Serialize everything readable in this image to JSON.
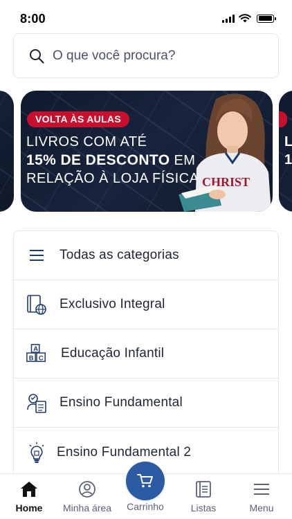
{
  "status_bar": {
    "time": "8:00"
  },
  "search": {
    "placeholder": "O que você procura?"
  },
  "banner": {
    "tag": "VOLTA ÀS AULAS",
    "line1": "LIVROS COM ATÉ",
    "highlight": "15% DE DESCONTO",
    "line2_suffix": " EM",
    "line3": "RELAÇÃO À LOJA FÍSICA",
    "shirt_text": "CHRIST",
    "next_line1": "L",
    "next_line2": "1"
  },
  "categories": {
    "items": [
      {
        "label": "Todas as categorias",
        "icon": "menu-icon"
      },
      {
        "label": "Exclusivo Integral",
        "icon": "book-globe-icon"
      },
      {
        "label": "Educação Infantil",
        "icon": "abc-blocks-icon"
      },
      {
        "label": "Ensino Fundamental",
        "icon": "student-book-icon"
      },
      {
        "label": "Ensino Fundamental 2",
        "icon": "lightbulb-icon"
      }
    ]
  },
  "bottom_nav": {
    "home": "Home",
    "account": "Minha área",
    "cart": "Carrinho",
    "lists": "Listas",
    "menu": "Menu",
    "active": "home"
  },
  "colors": {
    "primary": "#2c5ba3",
    "banner_bg": "#131d33",
    "tag_red": "#c8102e",
    "icon_navy": "#1e3a6e"
  }
}
